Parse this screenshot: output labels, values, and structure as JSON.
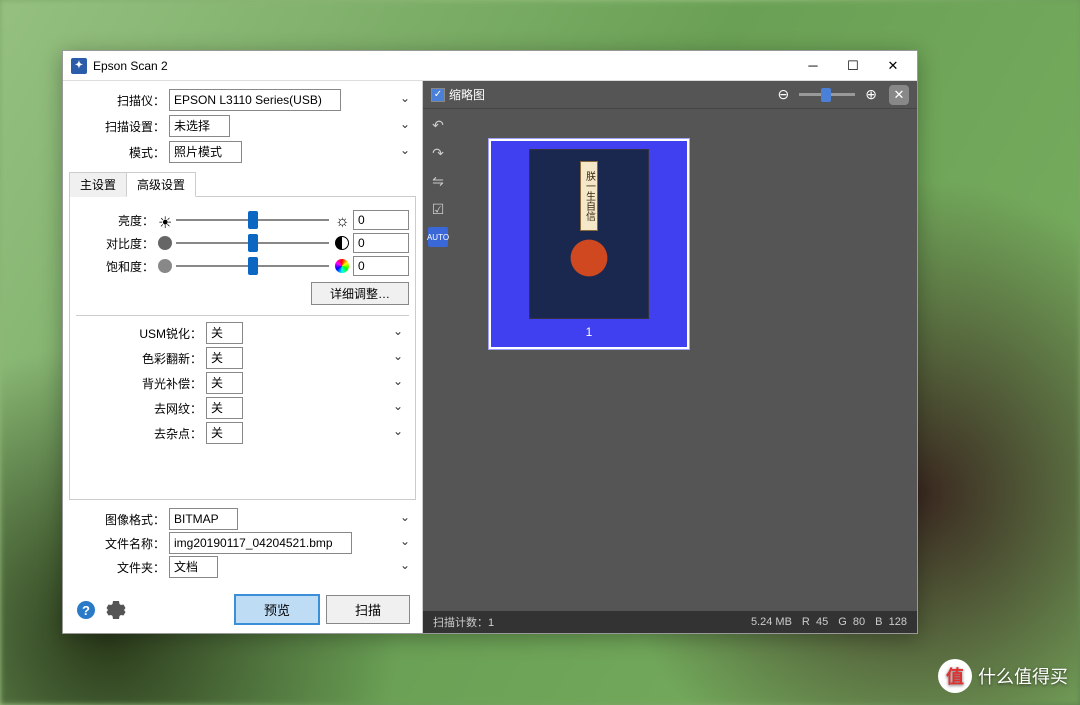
{
  "window": {
    "title": "Epson Scan 2"
  },
  "form": {
    "scanner_label": "扫描仪：",
    "scanner_value": "EPSON L3110 Series(USB)",
    "scan_settings_label": "扫描设置：",
    "scan_settings_value": "未选择",
    "mode_label": "模式：",
    "mode_value": "照片模式"
  },
  "tabs": {
    "main": "主设置",
    "advanced": "高级设置"
  },
  "sliders": {
    "brightness_label": "亮度：",
    "brightness_value": "0",
    "contrast_label": "对比度：",
    "contrast_value": "0",
    "saturation_label": "饱和度：",
    "saturation_value": "0",
    "detail_btn": "详细调整…"
  },
  "dropdowns": {
    "usm_label": "USM锐化：",
    "usm_value": "关",
    "color_label": "色彩翻新：",
    "color_value": "关",
    "backlight_label": "背光补偿：",
    "backlight_value": "关",
    "descreen_label": "去网纹：",
    "descreen_value": "关",
    "dust_label": "去杂点：",
    "dust_value": "关"
  },
  "output": {
    "format_label": "图像格式：",
    "format_value": "BITMAP",
    "filename_label": "文件名称：",
    "filename_value": "img20190117_04204521.bmp",
    "folder_label": "文件夹：",
    "folder_value": "文档"
  },
  "buttons": {
    "preview": "预览",
    "scan": "扫描"
  },
  "preview": {
    "thumbnail_label": "缩略图",
    "thumb_num": "1",
    "scroll_text": "朕一生自信",
    "auto": "AUTO"
  },
  "status": {
    "scan_count": "扫描计数：1",
    "size": "5.24 MB",
    "r": "R",
    "r_val": "45",
    "g": "G",
    "g_val": "80",
    "b": "B",
    "b_val": "128"
  },
  "watermark": "什么值得买"
}
